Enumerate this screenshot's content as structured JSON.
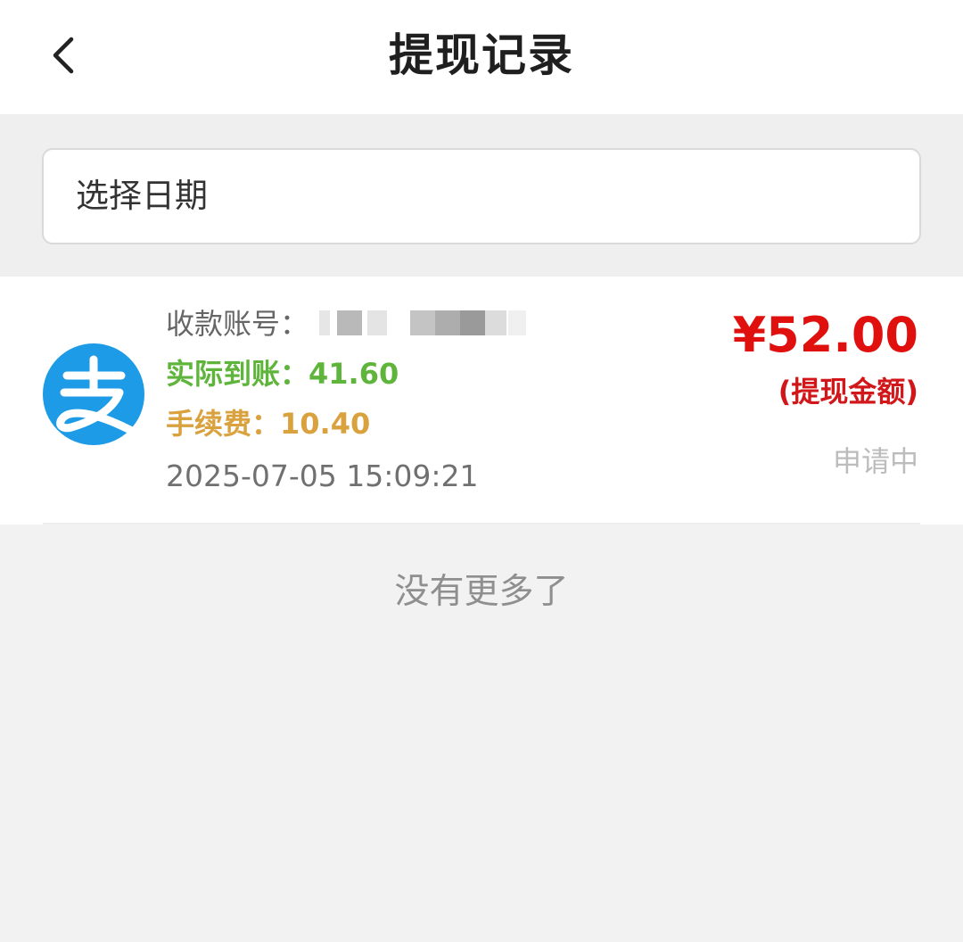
{
  "header": {
    "title": "提现记录",
    "back_icon": "chevron-left-icon"
  },
  "filter": {
    "date_placeholder": "选择日期"
  },
  "records": [
    {
      "channel_icon": "alipay-icon",
      "account_label": "收款账号：",
      "actual_label": "实际到账：",
      "actual_value": "41.60",
      "fee_label": "手续费：",
      "fee_value": "10.40",
      "time": "2025-07-05 15:09:21",
      "amount": "¥52.00",
      "amount_note": "(提现金额)",
      "status": "申请中"
    }
  ],
  "footer": {
    "no_more_text": "没有更多了"
  },
  "colors": {
    "amount": "#e0100f",
    "actual": "#5fb53b",
    "fee": "#d9a23e",
    "status": "#bcbcbc",
    "alipay_blue": "#1d9be7"
  }
}
